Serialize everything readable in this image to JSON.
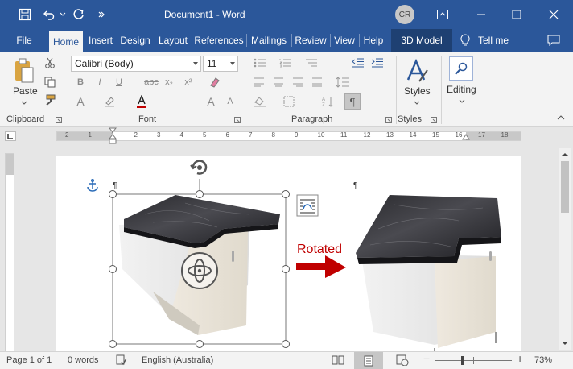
{
  "title_bar": {
    "document_name": "Document1",
    "separator": "-",
    "app_name": "Word",
    "user_initials": "CR"
  },
  "tabs": [
    {
      "label": "File"
    },
    {
      "label": "Home"
    },
    {
      "label": "Insert"
    },
    {
      "label": "Design"
    },
    {
      "label": "Layout"
    },
    {
      "label": "References"
    },
    {
      "label": "Mailings"
    },
    {
      "label": "Review"
    },
    {
      "label": "View"
    },
    {
      "label": "Help"
    },
    {
      "label": "3D Model"
    }
  ],
  "tell_me": "Tell me",
  "ribbon": {
    "clipboard": {
      "paste_label": "Paste",
      "group_label": "Clipboard"
    },
    "font": {
      "font_name": "Calibri (Body)",
      "font_size": "11",
      "group_label": "Font"
    },
    "paragraph": {
      "group_label": "Paragraph"
    },
    "styles": {
      "button_label": "Styles",
      "group_label": "Styles"
    },
    "editing": {
      "button_label": "Editing"
    }
  },
  "ruler": {
    "ticks": [
      "2",
      "1",
      "1",
      "2",
      "3",
      "4",
      "5",
      "6",
      "7",
      "8",
      "9",
      "10",
      "11",
      "12",
      "13",
      "14",
      "15",
      "16",
      "17",
      "18"
    ]
  },
  "document": {
    "pilcrow": "¶",
    "annotation_text": "Rotated",
    "annotation_color": "#c00000"
  },
  "status_bar": {
    "page": "Page 1 of 1",
    "words": "0 words",
    "language": "English (Australia)",
    "zoom": "73%"
  },
  "colors": {
    "title_bar": "#2b579a",
    "context_tab": "#1e4072",
    "selection_frame": "#555555"
  }
}
